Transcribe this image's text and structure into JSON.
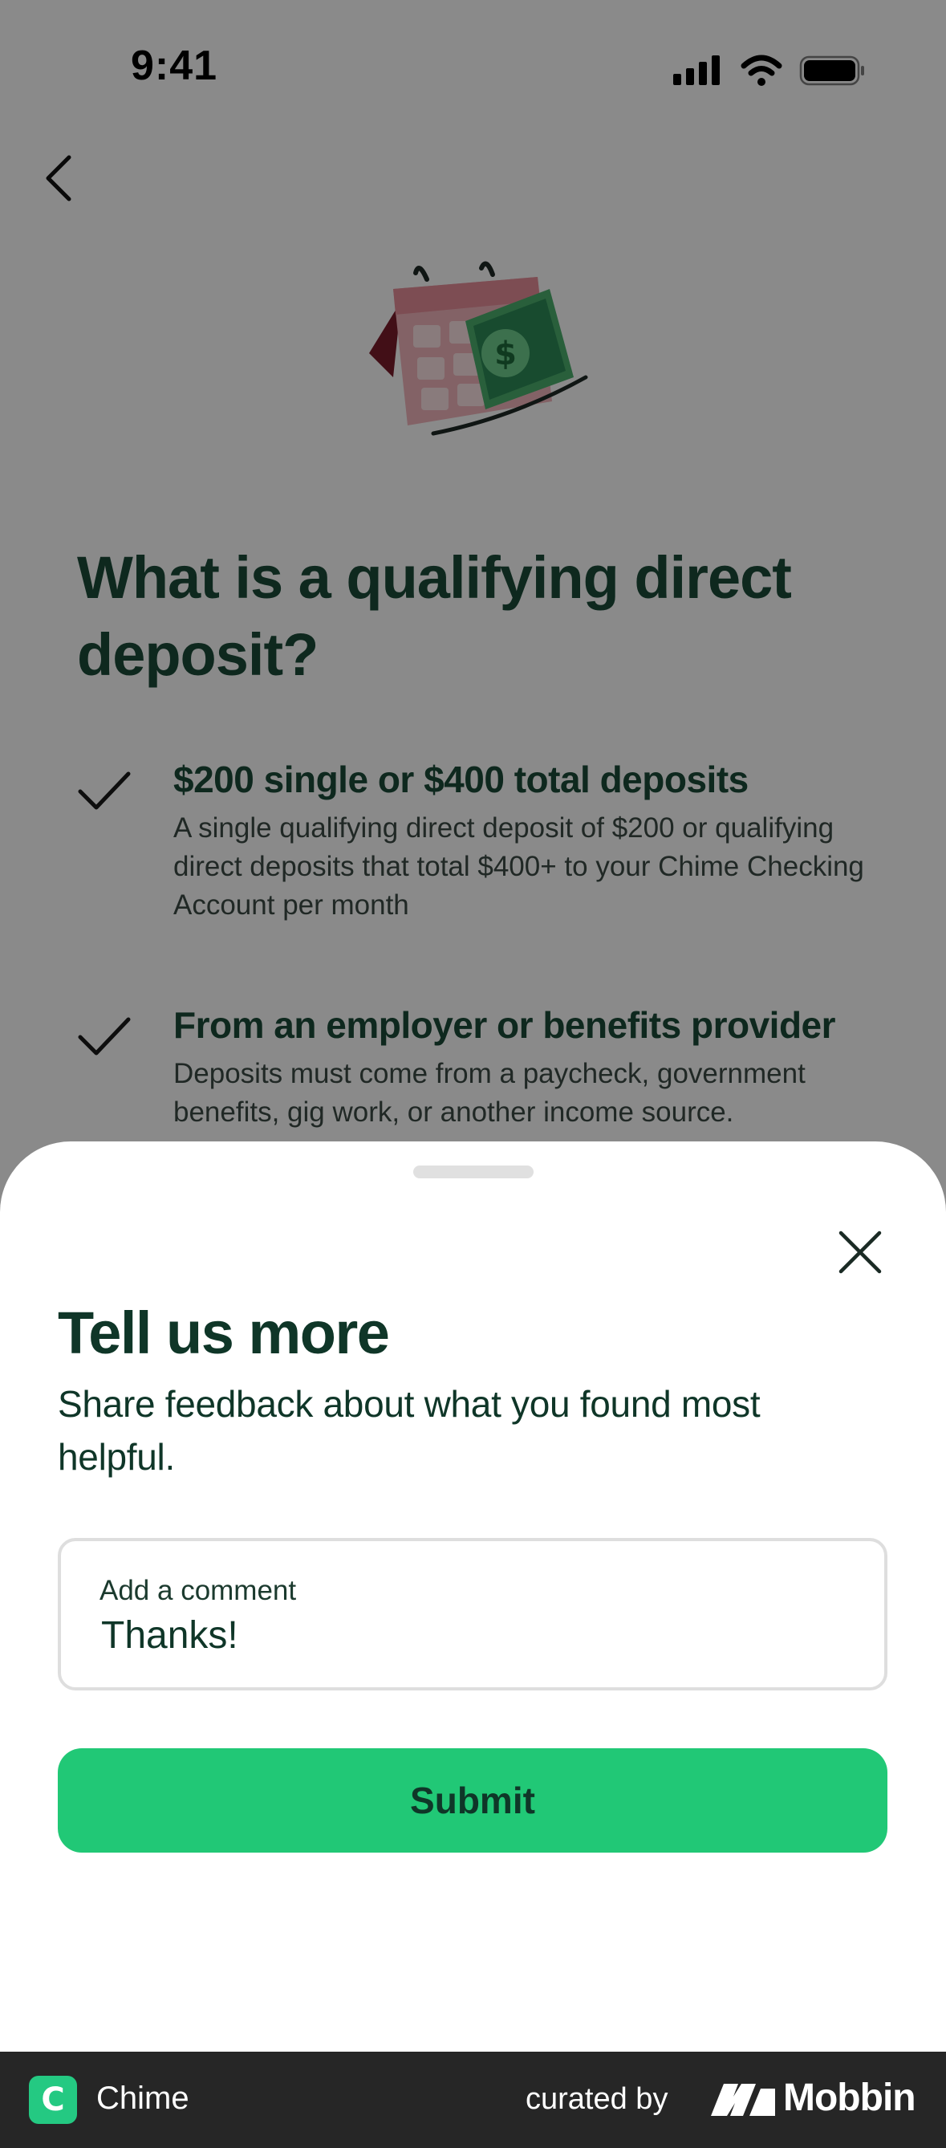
{
  "status_bar": {
    "time": "9:41"
  },
  "page": {
    "title": "What is a qualifying direct deposit?",
    "items": [
      {
        "heading": "$200 single or $400 total deposits",
        "description": "A single qualifying direct deposit of $200 or qualifying direct deposits that total $400+ to your Chime Checking Account per month"
      },
      {
        "heading": "From an employer or benefits provider",
        "description": "Deposits must come from a paycheck, government benefits, gig work, or another income source."
      }
    ]
  },
  "sheet": {
    "title": "Tell us more",
    "subtitle": "Share feedback about what you found most helpful.",
    "comment_label": "Add a comment",
    "comment_value": "Thanks!",
    "submit_label": "Submit"
  },
  "footer": {
    "app_name": "Chime",
    "app_logo_letter": "C",
    "curated_by": "curated by",
    "brand": "Mobbin"
  },
  "colors": {
    "accent": "#21c876",
    "text_dark_green": "#0f3628",
    "overlay": "rgba(0,0,0,0.46)",
    "footer_bg": "#262626"
  },
  "icons": {
    "back": "chevron-left-icon",
    "close": "close-icon",
    "check": "checkmark-icon",
    "hero": "calendar-money-illustration",
    "status": [
      "signal-icon",
      "wifi-icon",
      "battery-icon"
    ]
  }
}
